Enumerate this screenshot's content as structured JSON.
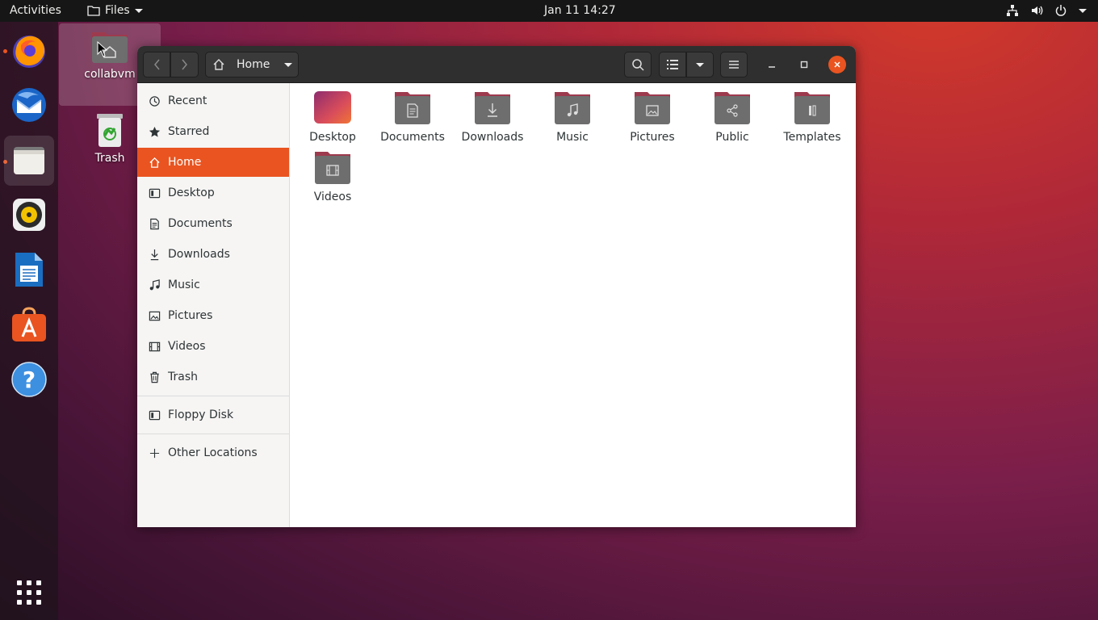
{
  "topbar": {
    "activities": "Activities",
    "app_menu": "Files",
    "clock": "Jan 11  14:27",
    "tray_icons": [
      "network-icon",
      "volume-icon",
      "power-icon",
      "chevron-down-icon"
    ]
  },
  "dock": {
    "items": [
      {
        "name": "firefox",
        "running": true
      },
      {
        "name": "thunderbird",
        "running": false
      },
      {
        "name": "files",
        "running": true,
        "active": true
      },
      {
        "name": "rhythmbox",
        "running": false
      },
      {
        "name": "libreoffice-writer",
        "running": false
      },
      {
        "name": "ubuntu-software",
        "running": false
      },
      {
        "name": "help",
        "running": false
      },
      {
        "name": "show-applications",
        "running": false
      }
    ]
  },
  "desktop": {
    "icons": [
      {
        "label": "collabvm",
        "icon": "home-folder-icon"
      },
      {
        "label": "Trash",
        "icon": "trash-icon"
      }
    ]
  },
  "window": {
    "path_label": "Home",
    "sidebar": {
      "items": [
        {
          "label": "Recent",
          "icon": "clock-icon"
        },
        {
          "label": "Starred",
          "icon": "star-icon"
        },
        {
          "label": "Home",
          "icon": "home-icon",
          "active": true
        },
        {
          "label": "Desktop",
          "icon": "desktop-icon"
        },
        {
          "label": "Documents",
          "icon": "document-icon"
        },
        {
          "label": "Downloads",
          "icon": "download-icon"
        },
        {
          "label": "Music",
          "icon": "music-icon"
        },
        {
          "label": "Pictures",
          "icon": "picture-icon"
        },
        {
          "label": "Videos",
          "icon": "video-icon"
        },
        {
          "label": "Trash",
          "icon": "trash-icon"
        }
      ],
      "devices": [
        {
          "label": "Floppy Disk",
          "icon": "floppy-icon"
        }
      ],
      "other": [
        {
          "label": "Other Locations",
          "icon": "plus-icon"
        }
      ]
    },
    "files": [
      {
        "label": "Desktop",
        "emblem": "none"
      },
      {
        "label": "Documents",
        "emblem": "document"
      },
      {
        "label": "Downloads",
        "emblem": "download"
      },
      {
        "label": "Music",
        "emblem": "music"
      },
      {
        "label": "Pictures",
        "emblem": "picture"
      },
      {
        "label": "Public",
        "emblem": "share"
      },
      {
        "label": "Templates",
        "emblem": "template"
      },
      {
        "label": "Videos",
        "emblem": "video"
      }
    ]
  },
  "colors": {
    "accent": "#e95420",
    "folder_tab": "#9e3a4e",
    "folder_body": "#6e6e6e",
    "headerbar": "#2f2f2f"
  }
}
